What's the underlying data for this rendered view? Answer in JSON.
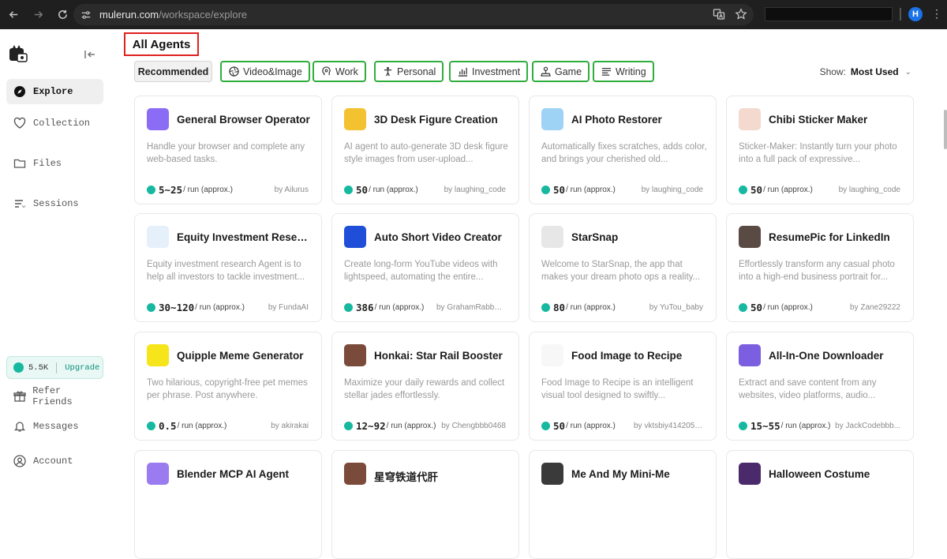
{
  "browser": {
    "url_host": "mulerun.com",
    "url_path": "/workspace/explore",
    "profile_initial": "H"
  },
  "sidebar": {
    "items": [
      {
        "label": "Explore",
        "icon": "compass-icon",
        "active": true
      },
      {
        "label": "Collection",
        "icon": "heart-icon"
      },
      {
        "label": "Files",
        "icon": "folder-icon"
      },
      {
        "label": "Sessions",
        "icon": "list-icon"
      }
    ],
    "credits": "5.5K",
    "upgrade_label": "Upgrade",
    "bottom_items": [
      {
        "label": "Refer Friends",
        "icon": "gift-icon"
      },
      {
        "label": "Messages",
        "icon": "bell-icon"
      },
      {
        "label": "Account",
        "icon": "user-icon"
      }
    ]
  },
  "main": {
    "title": "All Agents",
    "chips": [
      {
        "label": "Recommended"
      },
      {
        "label": "Video&Image",
        "icon": "aperture-icon"
      },
      {
        "label": "Work",
        "icon": "brain-icon"
      },
      {
        "label": "Personal",
        "icon": "person-icon"
      },
      {
        "label": "Investment",
        "icon": "chart-icon"
      },
      {
        "label": "Game",
        "icon": "joystick-icon"
      },
      {
        "label": "Writing",
        "icon": "text-icon"
      }
    ],
    "show_label": "Show:",
    "show_value": "Most Used",
    "price_unit": "/ run (approx.)"
  },
  "cards": [
    {
      "name": "General Browser Operator",
      "desc": "Handle your browser and complete any web-based tasks.",
      "price": "5~25",
      "author": "by Ailurus",
      "thumb_color": "#8b6cf5"
    },
    {
      "name": "3D Desk Figure Creation",
      "desc": "AI agent to auto-generate 3D desk figure style images from user-upload...",
      "price": "50",
      "author": "by laughing_code",
      "thumb_color": "#f2c230"
    },
    {
      "name": "AI Photo Restorer",
      "desc": "Automatically fixes scratches, adds color, and brings your cherished old...",
      "price": "50",
      "author": "by laughing_code",
      "thumb_color": "#9fd3f5"
    },
    {
      "name": "Chibi Sticker Maker",
      "desc": "Sticker-Maker: Instantly turn your photo into a full pack of expressive...",
      "price": "50",
      "author": "by laughing_code",
      "thumb_color": "#f4d9cf"
    },
    {
      "name": "Equity Investment Resear...",
      "desc": "Equity investment research Agent is to help all investors to tackle investment...",
      "price": "30~120",
      "author": "by FundaAI",
      "thumb_color": "#e6f0fb"
    },
    {
      "name": "Auto Short Video Creator",
      "desc": "Create long-form YouTube videos with lightspeed, automating the entire...",
      "price": "386",
      "author": "by GrahamRabbb0e...",
      "thumb_color": "#1f4fd8"
    },
    {
      "name": "StarSnap",
      "desc": "Welcome to StarSnap, the app that makes your dream photo ops a reality...",
      "price": "80",
      "author": "by YuTou_baby",
      "thumb_color": "#e7e7e7"
    },
    {
      "name": "ResumePic for LinkedIn",
      "desc": "Effortlessly transform any casual photo into a high-end business portrait for...",
      "price": "50",
      "author": "by Zane29222",
      "thumb_color": "#5a4a44"
    },
    {
      "name": "Quipple Meme Generator",
      "desc": "Two hilarious, copyright-free pet memes per phrase. Post anywhere.",
      "price": "0.5",
      "author": "by akirakai",
      "thumb_color": "#f6e51a"
    },
    {
      "name": "Honkai: Star Rail Booster",
      "desc": "Maximize your daily rewards and collect stellar jades effortlessly.",
      "price": "12~92",
      "author": "by Chengbbb0468",
      "thumb_color": "#7a4a3a"
    },
    {
      "name": "Food Image to Recipe",
      "desc": "Food Image to Recipe is an intelligent visual tool designed to swiftly...",
      "price": "50",
      "author": "by vktsbiy414205×1",
      "thumb_color": "#f7f7f7"
    },
    {
      "name": "All-In-One Downloader",
      "desc": "Extract and save content from any websites, video platforms, audio...",
      "price": "15~55",
      "author": "by JackCodebbb...",
      "thumb_color": "#7b5fe0"
    },
    {
      "name": "Blender MCP AI Agent",
      "desc": "",
      "price": "",
      "author": "",
      "thumb_color": "#9b7bf0"
    },
    {
      "name": "星穹铁道代肝",
      "desc": "",
      "price": "",
      "author": "",
      "thumb_color": "#7a4a3a"
    },
    {
      "name": "Me And My Mini-Me",
      "desc": "",
      "price": "",
      "author": "",
      "thumb_color": "#3a3a3a"
    },
    {
      "name": "Halloween Costume",
      "desc": "",
      "price": "",
      "author": "",
      "thumb_color": "#4a2a6a"
    }
  ]
}
